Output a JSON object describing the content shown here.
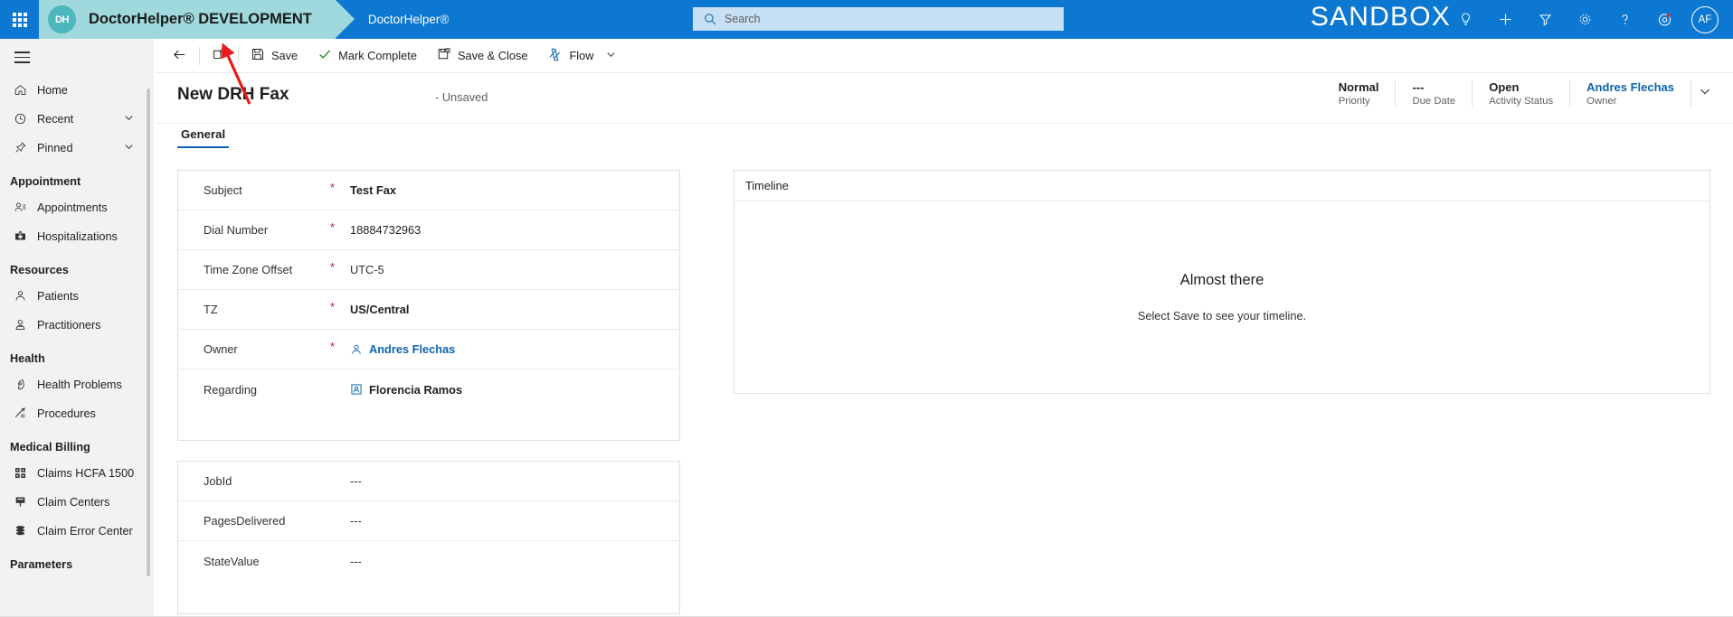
{
  "header": {
    "app_launcher_icon": "waffle-grid-icon",
    "brand_logo_text": "DH",
    "brand_title": "DoctorHelper® DEVELOPMENT",
    "app_name": "DoctorHelper®",
    "search": {
      "placeholder": "Search",
      "value": "",
      "icon": "search-icon"
    },
    "environment_label": "SANDBOX",
    "icons": [
      "lightbulb-icon",
      "plus-icon",
      "filter-icon",
      "gear-icon",
      "question-icon",
      "assistant-icon"
    ],
    "avatar_initials": "AF"
  },
  "commandbar": {
    "back_icon": "back-arrow-icon",
    "popout_icon": "open-in-new-window-icon",
    "save_label": "Save",
    "save_icon": "save-disk-icon",
    "mark_complete_label": "Mark Complete",
    "mark_complete_icon": "checkmark-icon",
    "save_close_label": "Save & Close",
    "save_close_icon": "save-close-icon",
    "flow_label": "Flow",
    "flow_icon": "flow-icon",
    "flow_chevron_icon": "chevron-down-icon"
  },
  "page": {
    "title": "New DRH Fax",
    "subtitle": "- Unsaved",
    "stats": [
      {
        "value": "Normal",
        "label": "Priority",
        "link": false
      },
      {
        "value": "---",
        "label": "Due Date",
        "link": false
      },
      {
        "value": "Open",
        "label": "Activity Status",
        "link": false
      },
      {
        "value": "Andres Flechas",
        "label": "Owner",
        "link": true
      }
    ],
    "expand_chevron_icon": "chevron-down-icon"
  },
  "tabs": [
    {
      "label": "General",
      "active": true
    }
  ],
  "form": {
    "card_one": [
      {
        "label": "Subject",
        "required": true,
        "value": "Test Fax",
        "style": "bold",
        "icon": ""
      },
      {
        "label": "Dial Number",
        "required": true,
        "value": "18884732963",
        "style": "plain",
        "icon": ""
      },
      {
        "label": "Time Zone Offset",
        "required": true,
        "value": "UTC-5",
        "style": "dim",
        "icon": ""
      },
      {
        "label": "TZ",
        "required": true,
        "value": "US/Central",
        "style": "bold",
        "icon": ""
      },
      {
        "label": "Owner",
        "required": true,
        "value": "Andres Flechas",
        "style": "lookup",
        "icon": "user-icon"
      },
      {
        "label": "Regarding",
        "required": false,
        "value": "Florencia Ramos",
        "style": "bold",
        "icon": "contact-card-icon"
      }
    ],
    "card_two": [
      {
        "label": "JobId",
        "required": false,
        "value": "---",
        "style": "dim",
        "icon": ""
      },
      {
        "label": "PagesDelivered",
        "required": false,
        "value": "---",
        "style": "dim",
        "icon": ""
      },
      {
        "label": "StateValue",
        "required": false,
        "value": "---",
        "style": "dim",
        "icon": ""
      }
    ]
  },
  "timeline": {
    "header": "Timeline",
    "empty_title": "Almost there",
    "empty_subtitle": "Select Save to see your timeline."
  },
  "sidebar": {
    "menu_icon": "hamburger-icon",
    "items": [
      {
        "label": "Home",
        "icon": "home-icon",
        "chevron": false,
        "type": "item"
      },
      {
        "label": "Recent",
        "icon": "clock-icon",
        "chevron": true,
        "type": "item"
      },
      {
        "label": "Pinned",
        "icon": "pin-icon",
        "chevron": true,
        "type": "item"
      },
      {
        "label": "Appointment",
        "icon": "",
        "chevron": false,
        "type": "group"
      },
      {
        "label": "Appointments",
        "icon": "appointments-icon",
        "chevron": false,
        "type": "item"
      },
      {
        "label": "Hospitalizations",
        "icon": "hospital-icon",
        "chevron": false,
        "type": "item"
      },
      {
        "label": "Resources",
        "icon": "",
        "chevron": false,
        "type": "group"
      },
      {
        "label": "Patients",
        "icon": "patient-icon",
        "chevron": false,
        "type": "item"
      },
      {
        "label": "Practitioners",
        "icon": "practitioner-icon",
        "chevron": false,
        "type": "item"
      },
      {
        "label": "Health",
        "icon": "",
        "chevron": false,
        "type": "group"
      },
      {
        "label": "Health Problems",
        "icon": "health-problem-icon",
        "chevron": false,
        "type": "item"
      },
      {
        "label": "Procedures",
        "icon": "procedure-icon",
        "chevron": false,
        "type": "item"
      },
      {
        "label": "Medical Billing",
        "icon": "",
        "chevron": false,
        "type": "group"
      },
      {
        "label": "Claims HCFA 1500",
        "icon": "claims-form-icon",
        "chevron": false,
        "type": "item"
      },
      {
        "label": "Claim Centers",
        "icon": "claim-center-icon",
        "chevron": false,
        "type": "item"
      },
      {
        "label": "Claim Error Center",
        "icon": "claim-error-icon",
        "chevron": false,
        "type": "item"
      },
      {
        "label": "Parameters",
        "icon": "",
        "chevron": false,
        "type": "group"
      }
    ]
  },
  "annotation": {
    "color": "#e8191c",
    "points_to": "save-button"
  }
}
